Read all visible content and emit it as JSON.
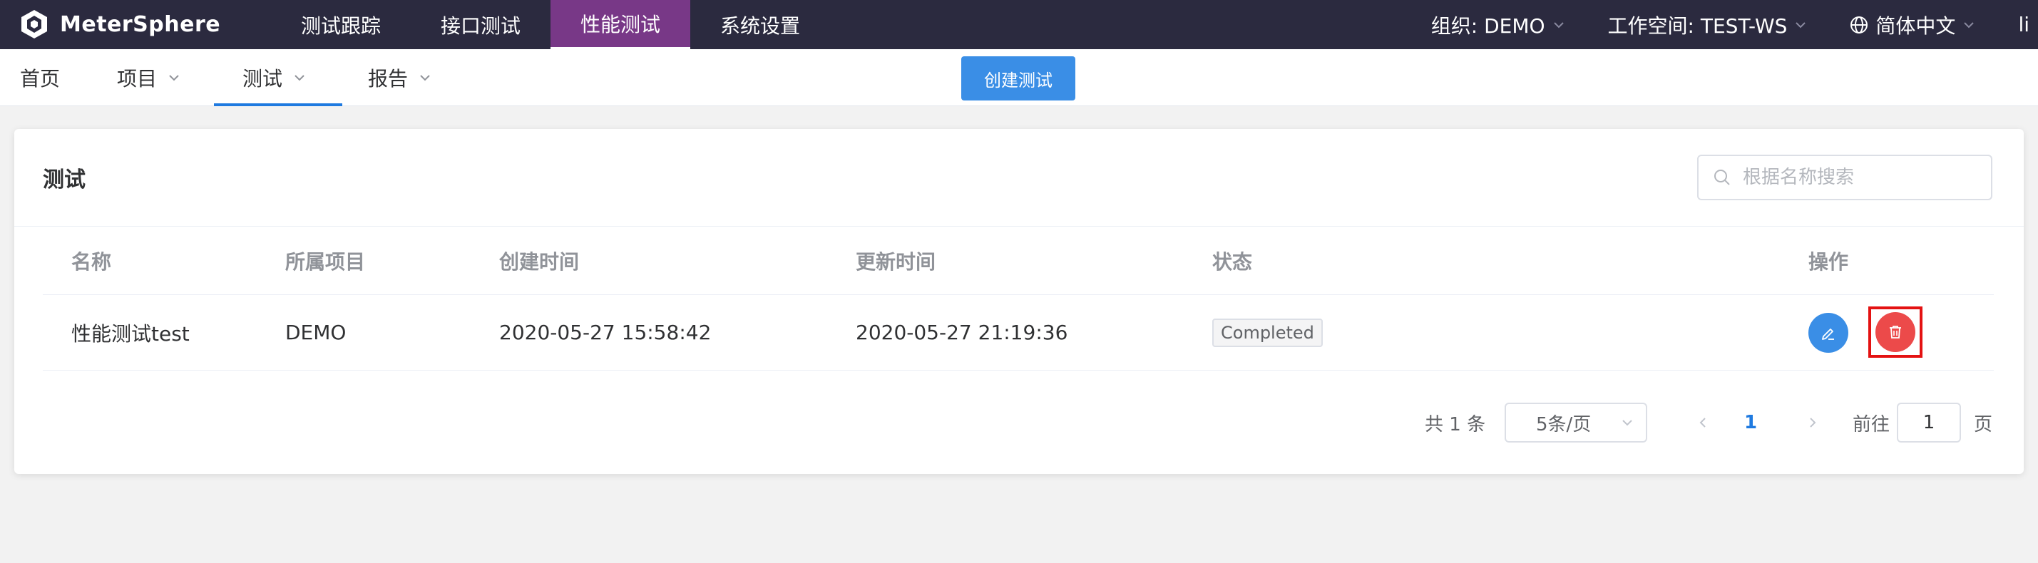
{
  "app": {
    "name": "MeterSphere"
  },
  "topnav": {
    "items": [
      {
        "label": "测试跟踪"
      },
      {
        "label": "接口测试"
      },
      {
        "label": "性能测试",
        "active": true
      },
      {
        "label": "系统设置"
      }
    ],
    "org_label": "组织: DEMO",
    "workspace_label": "工作空间: TEST-WS",
    "language_label": "简体中文",
    "user_label": "li"
  },
  "subnav": {
    "home": "首页",
    "project": "项目",
    "test": "测试",
    "report": "报告",
    "create_button": "创建测试"
  },
  "card": {
    "title": "测试",
    "search_placeholder": "根据名称搜索"
  },
  "table": {
    "columns": [
      "名称",
      "所属项目",
      "创建时间",
      "更新时间",
      "状态",
      "操作"
    ],
    "rows": [
      {
        "name": "性能测试test",
        "project": "DEMO",
        "created": "2020-05-27 15:58:42",
        "updated": "2020-05-27 21:19:36",
        "status": "Completed"
      }
    ]
  },
  "pagination": {
    "total_label": "共 1 条",
    "page_size": "5条/页",
    "current_page": "1",
    "goto_prefix": "前往",
    "goto_value": "1",
    "goto_suffix": "页"
  },
  "colors": {
    "topbar_bg": "#2b2a3f",
    "active_nav": "#783887",
    "primary": "#3a8ee6",
    "danger": "#ec4a4a",
    "highlight_border": "#e41212"
  },
  "icons": {
    "logo": "metersphere-logo-icon",
    "language": "globe-icon",
    "search": "search-icon",
    "edit": "edit-pencil-icon",
    "delete": "trash-icon"
  }
}
